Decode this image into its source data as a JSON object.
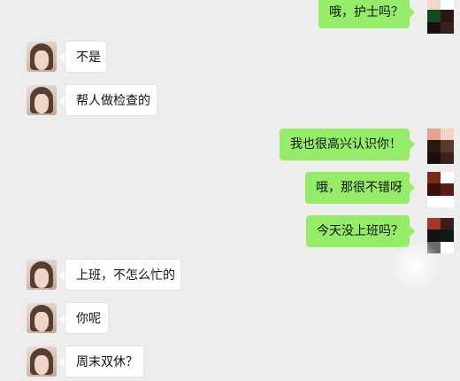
{
  "chat": {
    "messages": [
      {
        "side": "right",
        "text": "哦，护士吗？",
        "avatar": "contact-avatar-self"
      },
      {
        "side": "left",
        "text": "不是",
        "avatar": "contact-avatar-woman"
      },
      {
        "side": "left",
        "text": "帮人做检查的",
        "avatar": "contact-avatar-woman"
      },
      {
        "side": "right",
        "text": "我也很高兴认识你！",
        "avatar": "contact-avatar-self"
      },
      {
        "side": "right",
        "text": "哦，那很不错呀",
        "avatar": "contact-avatar-self"
      },
      {
        "side": "right",
        "text": "今天没上班吗？",
        "avatar": "contact-avatar-self"
      },
      {
        "side": "left",
        "text": "上班，不怎么忙的",
        "avatar": "contact-avatar-woman"
      },
      {
        "side": "left",
        "text": "你呢",
        "avatar": "contact-avatar-woman"
      },
      {
        "side": "left",
        "text": "周末双休？",
        "avatar": "contact-avatar-woman"
      }
    ]
  },
  "colors": {
    "background": "#ededed",
    "outgoing_bubble": "#95ec69",
    "incoming_bubble": "#ffffff"
  }
}
